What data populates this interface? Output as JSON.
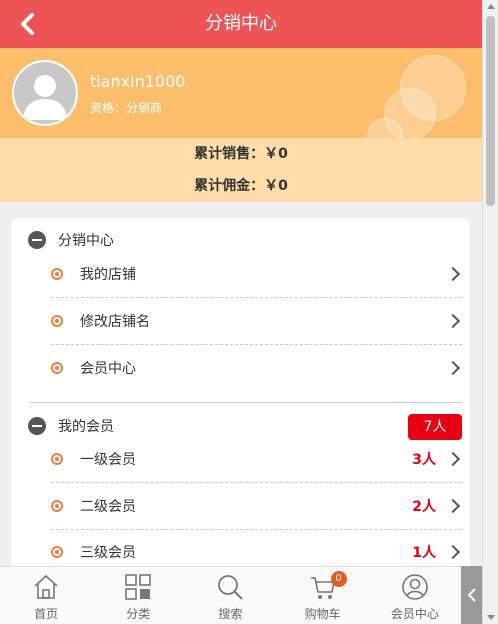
{
  "header": {
    "title": "分销中心"
  },
  "profile": {
    "username": "tianxin1000",
    "qualification": "资格：分销商"
  },
  "stats": {
    "sales": "累计销售：￥0",
    "commission": "累计佣金：￥0"
  },
  "distribution": {
    "title": "分销中心",
    "items": [
      {
        "label": "我的店铺"
      },
      {
        "label": "修改店铺名"
      },
      {
        "label": "会员中心"
      }
    ]
  },
  "members": {
    "title": "我的会员",
    "total": "7人",
    "items": [
      {
        "label": "一级会员",
        "count": "3人"
      },
      {
        "label": "二级会员",
        "count": "2人"
      },
      {
        "label": "三级会员",
        "count": "1人"
      }
    ]
  },
  "nav": [
    {
      "label": "首页",
      "icon": "home-icon"
    },
    {
      "label": "分类",
      "icon": "category-icon"
    },
    {
      "label": "搜索",
      "icon": "search-icon"
    },
    {
      "label": "购物车",
      "icon": "cart-icon",
      "badge": "0"
    },
    {
      "label": "会员中心",
      "icon": "user-icon"
    }
  ],
  "colors": {
    "header": "#ee5356",
    "profile": "#fdbe6c",
    "stats": "#ffdca8",
    "accent": "#e60012",
    "dot": "#ee7f3c"
  }
}
